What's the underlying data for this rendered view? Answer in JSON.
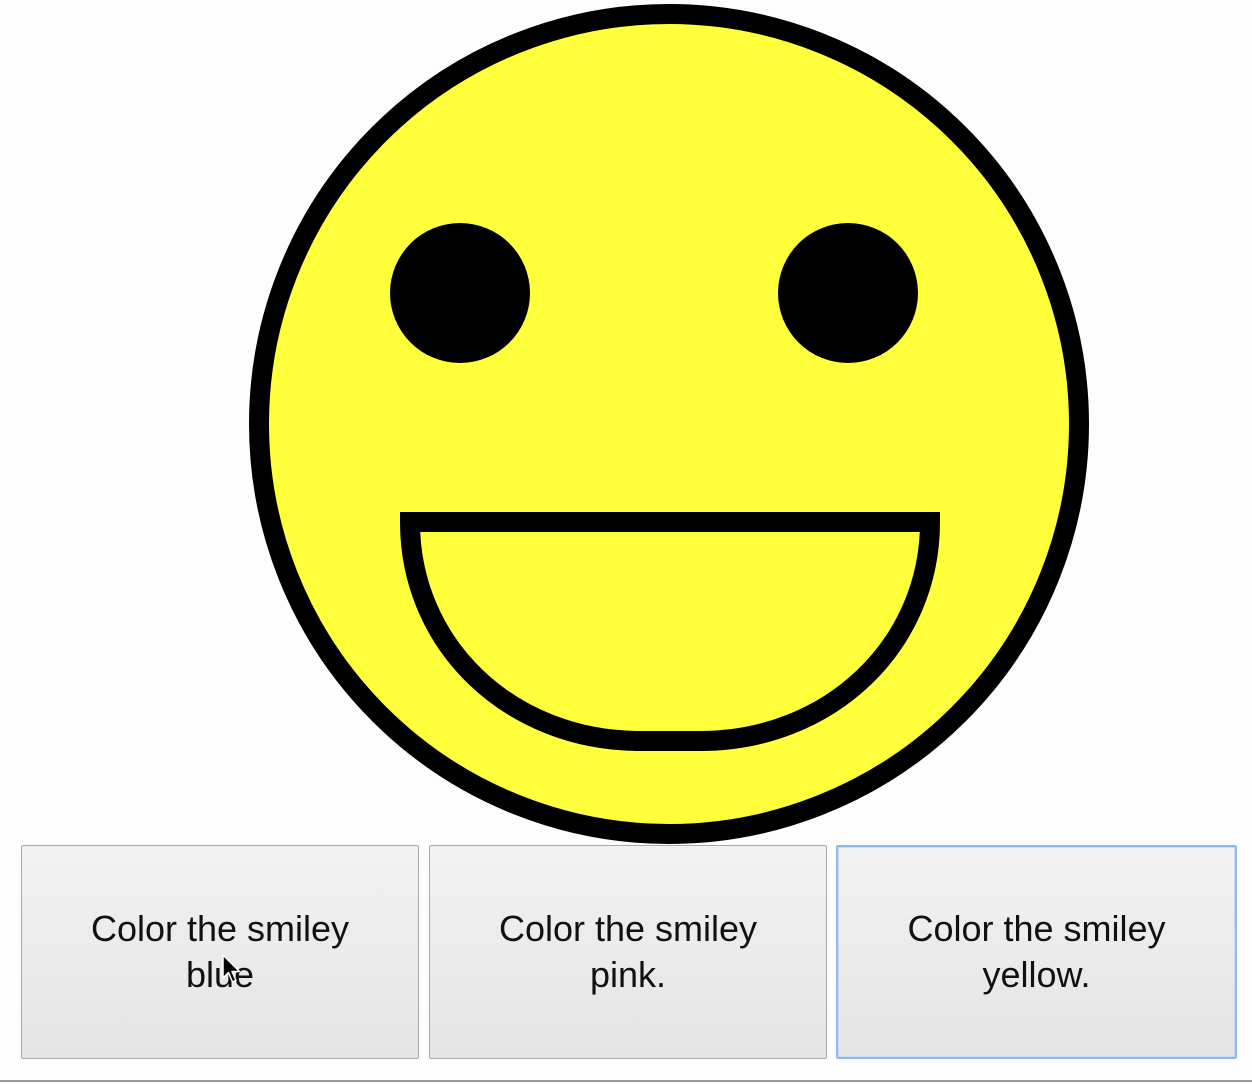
{
  "smiley": {
    "face_color": "#ffff3c",
    "outline_color": "#000000",
    "eye_color": "#000000"
  },
  "buttons": [
    {
      "label": "Color the smiley blue",
      "color": "blue"
    },
    {
      "label": "Color the smiley pink.",
      "color": "pink"
    },
    {
      "label": "Color the smiley yellow.",
      "color": "yellow",
      "focused": true
    }
  ],
  "cursor": {
    "icon": "arrow-cursor-icon"
  }
}
